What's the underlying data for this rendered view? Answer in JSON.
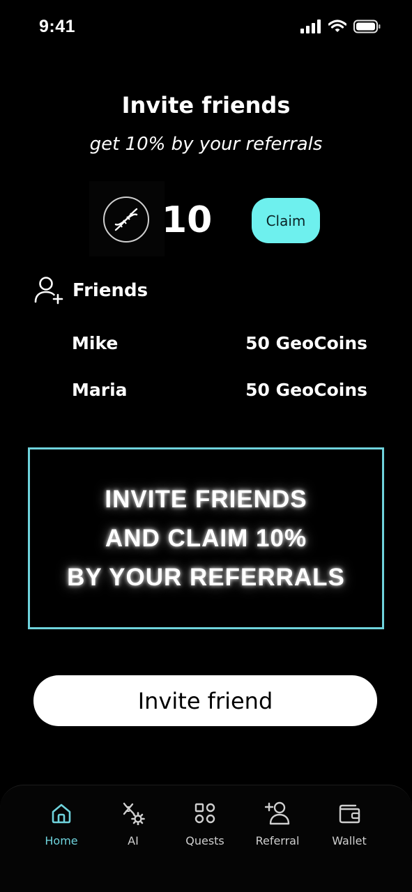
{
  "status_bar": {
    "time": "9:41"
  },
  "header": {
    "title": "Invite friends",
    "subtitle": "get 10% by your referrals"
  },
  "balance": {
    "value": "10",
    "claim_label": "Claim"
  },
  "friends": {
    "label": "Friends",
    "items": [
      {
        "name": "Mike",
        "reward": "50 GeoCoins"
      },
      {
        "name": "Maria",
        "reward": "50 GeoCoins"
      }
    ]
  },
  "promo": {
    "lines": [
      "INVITE FRIENDS",
      "AND CLAIM 10%",
      "BY YOUR REFERRALS"
    ]
  },
  "invite_button": {
    "label": "Invite friend"
  },
  "tab_bar": {
    "items": [
      {
        "label": "Home",
        "icon": "home-icon",
        "active": true
      },
      {
        "label": "AI",
        "icon": "dna-gear-icon",
        "active": false
      },
      {
        "label": "Quests",
        "icon": "quests-grid-icon",
        "active": false
      },
      {
        "label": "Referral",
        "icon": "add-user-icon",
        "active": false
      },
      {
        "label": "Wallet",
        "icon": "wallet-icon",
        "active": false
      }
    ]
  },
  "colors": {
    "accent": "#6ef0ee",
    "promo_border": "#6fd3dc",
    "background": "#000000"
  }
}
